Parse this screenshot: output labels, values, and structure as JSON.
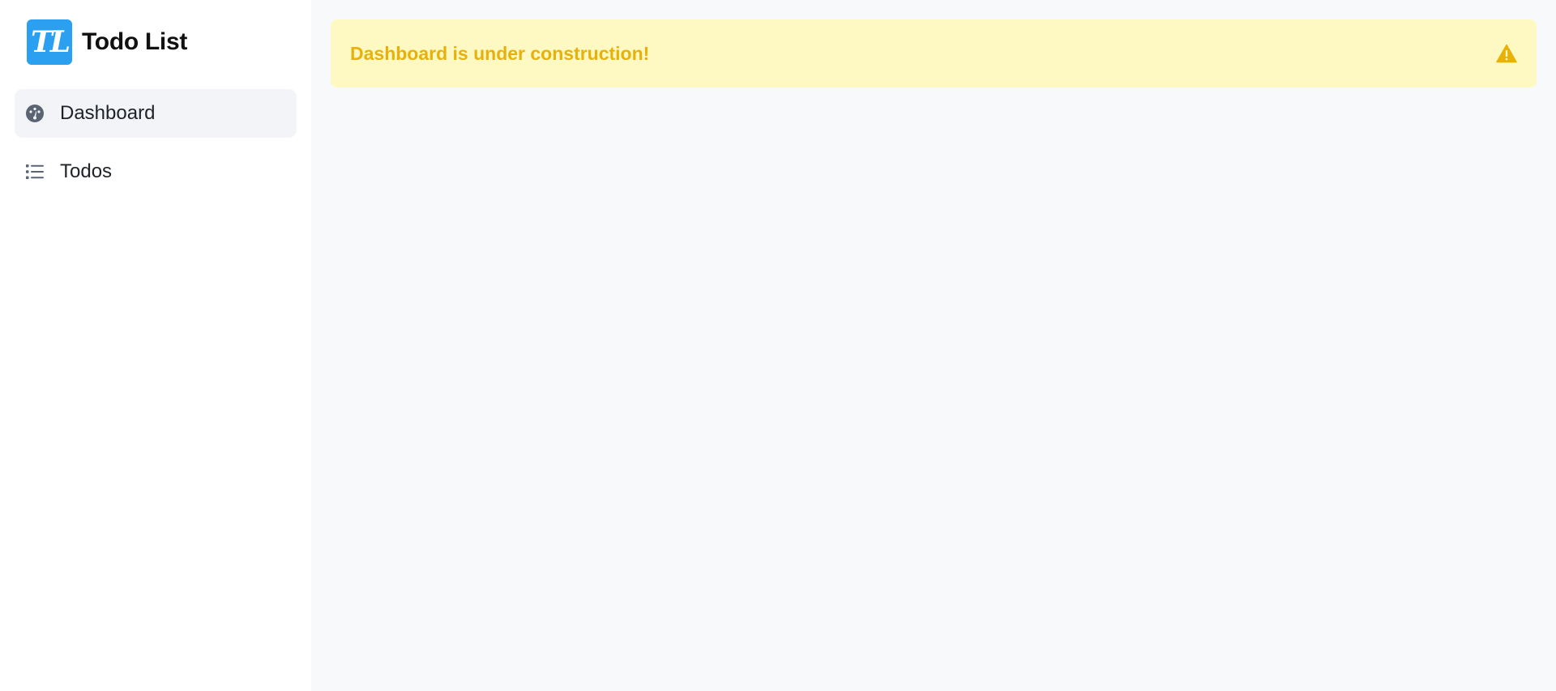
{
  "brand": {
    "logo_text": "TL",
    "title": "Todo List",
    "logo_color": "#2b9ff0"
  },
  "sidebar": {
    "items": [
      {
        "label": "Dashboard",
        "icon": "dashboard-icon",
        "active": true
      },
      {
        "label": "Todos",
        "icon": "list-icon",
        "active": false
      }
    ]
  },
  "alert": {
    "message": "Dashboard is under construction!",
    "icon": "warning-icon",
    "text_color": "#e8b10a",
    "background": "#fef9c3"
  }
}
